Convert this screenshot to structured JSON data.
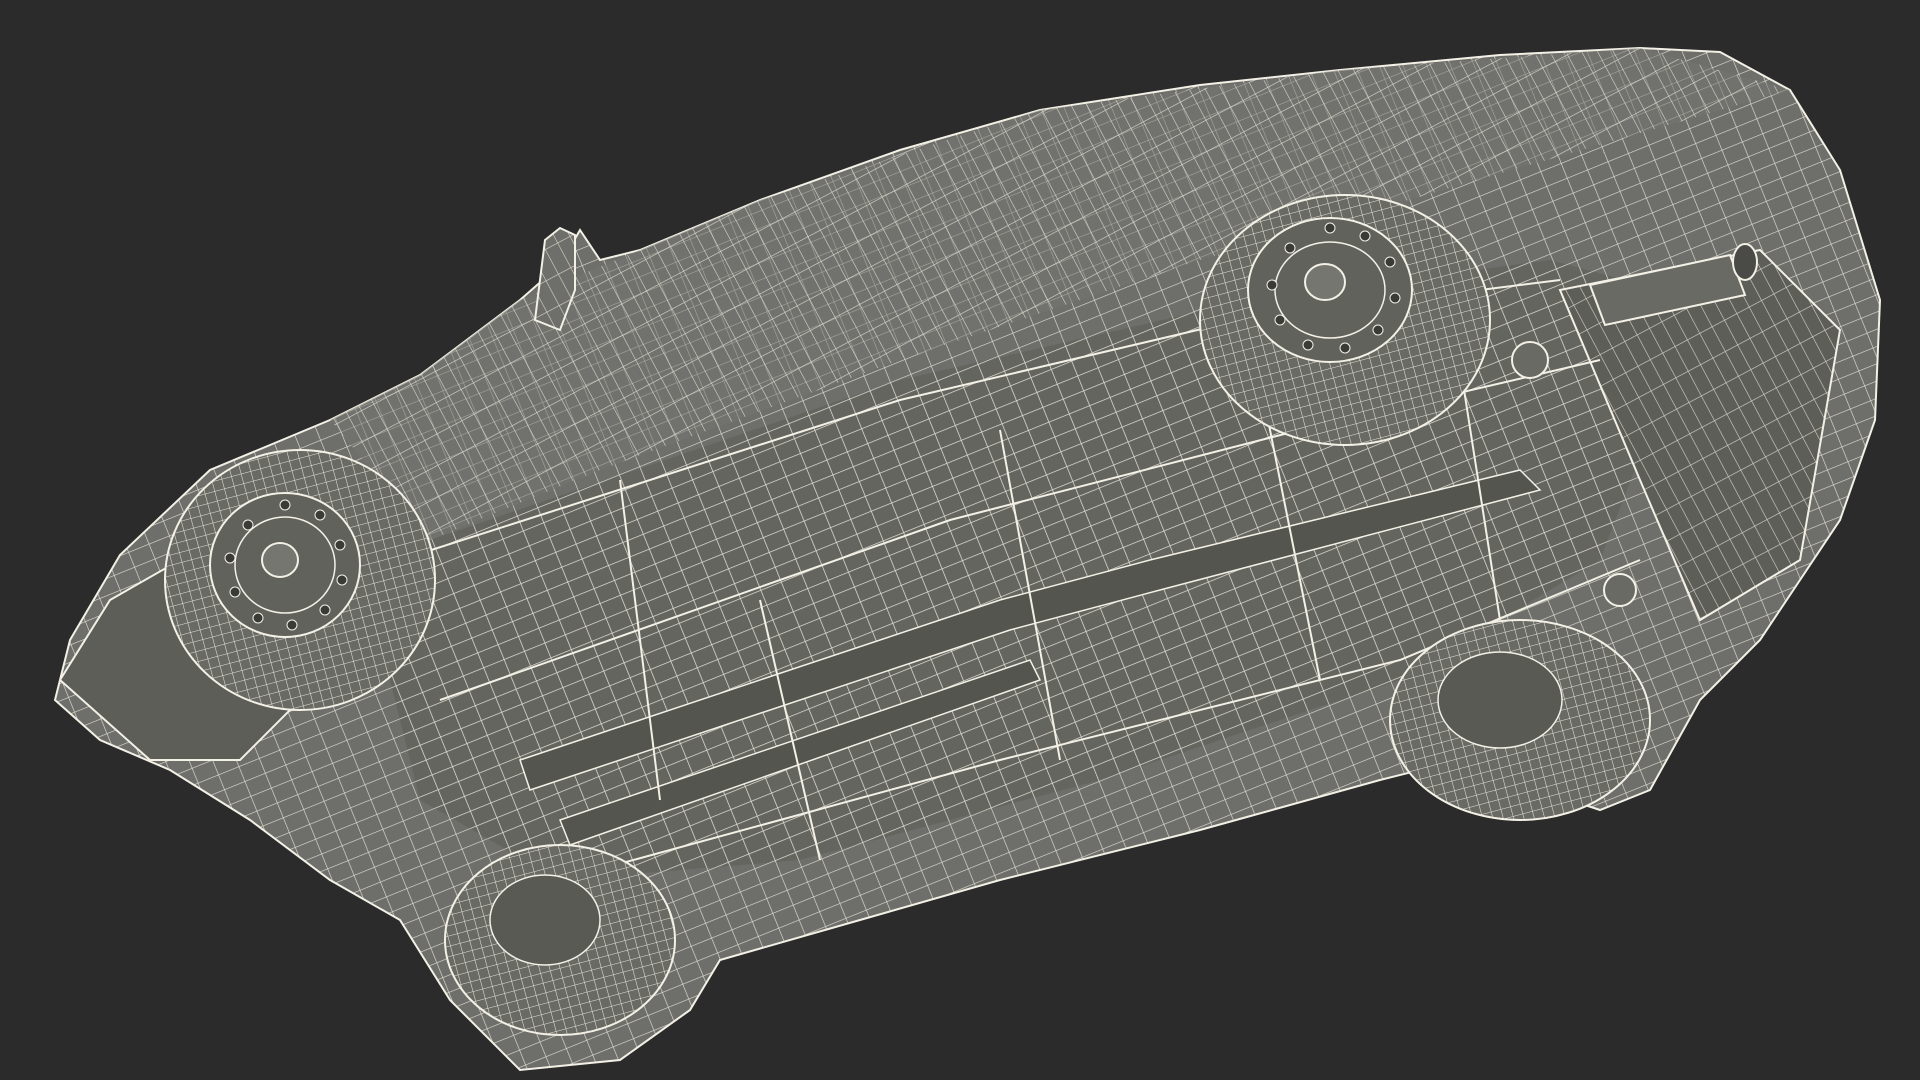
{
  "scene": {
    "background_color": "#2b2b2b",
    "body_color": "#6e6e6a",
    "body_dark_color": "#55554f",
    "wire_color": "#f3f1e6",
    "subject": "car-underside-wireframe",
    "icons": [
      "wheel-icon"
    ]
  }
}
